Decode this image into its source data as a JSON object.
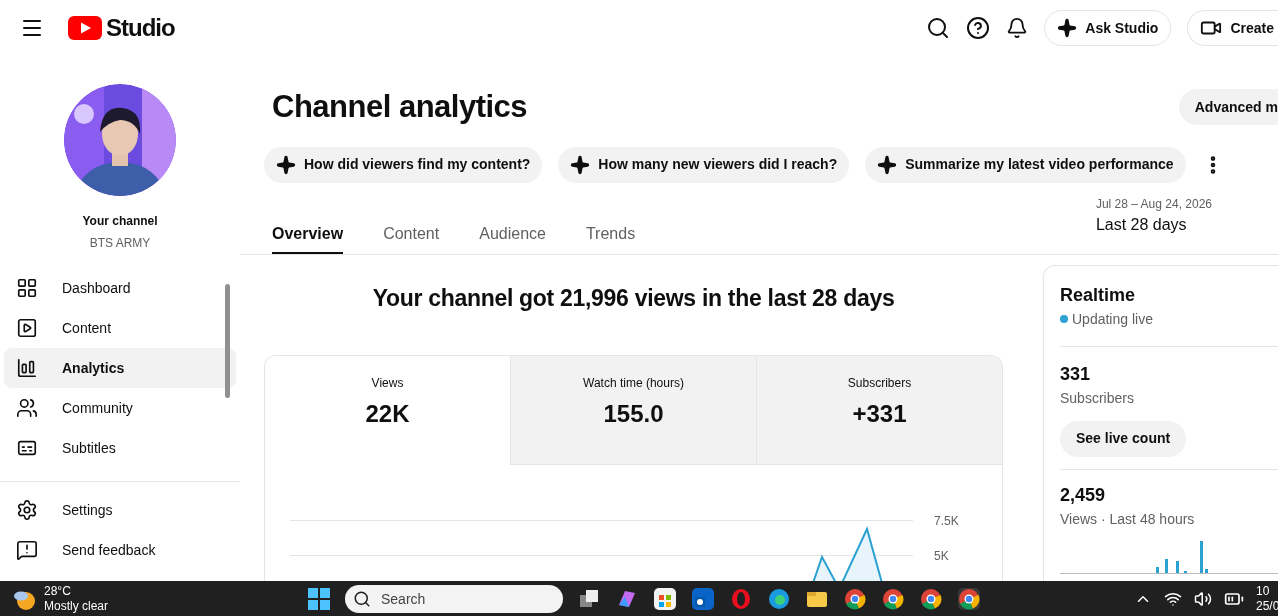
{
  "header": {
    "logo_text": "Studio",
    "ask_button": "Ask Studio",
    "create_button": "Create"
  },
  "sidebar": {
    "channel_label": "Your channel",
    "channel_name": "BTS ARMY",
    "items": [
      {
        "label": "Dashboard",
        "selected": false
      },
      {
        "label": "Content",
        "selected": false
      },
      {
        "label": "Analytics",
        "selected": true
      },
      {
        "label": "Community",
        "selected": false
      },
      {
        "label": "Subtitles",
        "selected": false
      }
    ],
    "footer_items": [
      {
        "label": "Settings"
      },
      {
        "label": "Send feedback"
      }
    ]
  },
  "page": {
    "title": "Channel analytics",
    "advanced_button": "Advanced m",
    "suggestions": [
      "How did viewers find my content?",
      "How many new viewers did I reach?",
      "Summarize my latest video performance"
    ],
    "tabs": [
      {
        "label": "Overview",
        "selected": true
      },
      {
        "label": "Content",
        "selected": false
      },
      {
        "label": "Audience",
        "selected": false
      },
      {
        "label": "Trends",
        "selected": false
      }
    ],
    "date_range": "Jul 28 – Aug 24, 2026",
    "period": "Last 28 days",
    "headline": "Your channel got 21,996 views in the last 28 days",
    "metrics": [
      {
        "label": "Views",
        "value": "22K",
        "selected": true
      },
      {
        "label": "Watch time (hours)",
        "value": "155.0",
        "selected": false
      },
      {
        "label": "Subscribers",
        "value": "+331",
        "selected": false
      }
    ],
    "chart_ticks": [
      "7.5K",
      "5K"
    ]
  },
  "realtime": {
    "title": "Realtime",
    "status": "Updating live",
    "subscribers": "331",
    "subscribers_label": "Subscribers",
    "live_button": "See live count",
    "views": "2,459",
    "views_label": "Views · Last 48 hours"
  },
  "taskbar": {
    "weather_temp": "28°C",
    "weather_text": "Mostly clear",
    "search_placeholder": "Search",
    "time": "10",
    "date": "25/0"
  }
}
